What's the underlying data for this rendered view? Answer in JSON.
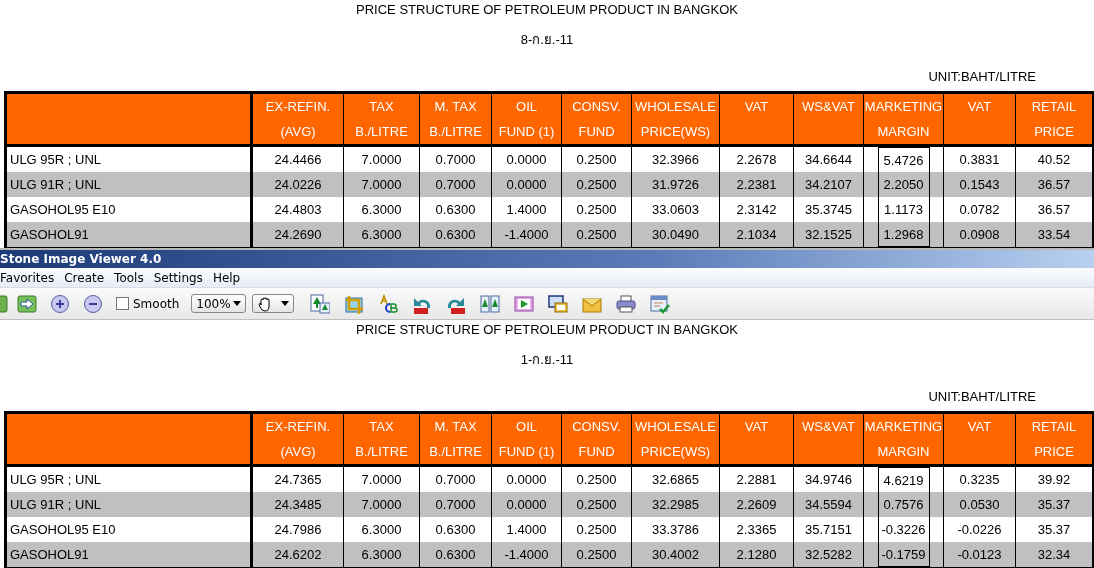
{
  "background_document": {
    "title": "PRICE STRUCTURE OF PETROLEUM PRODUCT IN BANGKOK",
    "date": "8-ก.ย.-11",
    "unit": "UNIT:BAHT/LITRE",
    "columns": [
      {
        "line1": "EX-REFIN.",
        "line2": "(AVG)"
      },
      {
        "line1": "TAX",
        "line2": "B./LITRE"
      },
      {
        "line1": "M. TAX",
        "line2": "B./LITRE"
      },
      {
        "line1": "OIL",
        "line2": "FUND (1)"
      },
      {
        "line1": "CONSV.",
        "line2": "FUND"
      },
      {
        "line1": "WHOLESALE",
        "line2": "PRICE(WS)"
      },
      {
        "line1": "VAT"
      },
      {
        "line1": "WS&VAT"
      },
      {
        "line1": "MARKETING",
        "line2": "MARGIN"
      },
      {
        "line1": "VAT"
      },
      {
        "line1": "RETAIL",
        "line2": "PRICE"
      }
    ],
    "rows": [
      {
        "product": "ULG 95R ; UNL",
        "cells": [
          "24.4466",
          "7.0000",
          "0.7000",
          "0.0000",
          "0.2500",
          "32.3966",
          "2.2678",
          "34.6644",
          "5.4726",
          "0.3831",
          "40.52"
        ]
      },
      {
        "product": "ULG 91R ; UNL",
        "cells": [
          "24.0226",
          "7.0000",
          "0.7000",
          "0.0000",
          "0.2500",
          "31.9726",
          "2.2381",
          "34.2107",
          "2.2050",
          "0.1543",
          "36.57"
        ]
      },
      {
        "product": "GASOHOL95 E10",
        "cells": [
          "24.4803",
          "6.3000",
          "0.6300",
          "1.4000",
          "0.2500",
          "33.0603",
          "2.3142",
          "35.3745",
          "1.1173",
          "0.0782",
          "36.57"
        ]
      },
      {
        "product": "GASOHOL91",
        "cells": [
          "24.2690",
          "6.3000",
          "0.6300",
          "-1.4000",
          "0.2500",
          "30.0490",
          "2.1034",
          "32.1525",
          "1.2968",
          "0.0908",
          "33.54"
        ]
      }
    ]
  },
  "viewer": {
    "title": "Stone Image Viewer 4.0",
    "menu": [
      "Favorites",
      "Create",
      "Tools",
      "Settings",
      "Help"
    ],
    "toolbar": {
      "smooth": {
        "label": "Smooth",
        "checked": false
      },
      "zoom": "100%"
    },
    "document": {
      "title": "PRICE STRUCTURE OF PETROLEUM PRODUCT IN BANGKOK",
      "date": "1-ก.ย.-11",
      "unit": "UNIT:BAHT/LITRE",
      "columns": [
        {
          "line1": "EX-REFIN.",
          "line2": "(AVG)"
        },
        {
          "line1": "TAX",
          "line2": "B./LITRE"
        },
        {
          "line1": "M. TAX",
          "line2": "B./LITRE"
        },
        {
          "line1": "OIL",
          "line2": "FUND (1)"
        },
        {
          "line1": "CONSV.",
          "line2": "FUND"
        },
        {
          "line1": "WHOLESALE",
          "line2": "PRICE(WS)"
        },
        {
          "line1": "VAT"
        },
        {
          "line1": "WS&VAT"
        },
        {
          "line1": "MARKETING",
          "line2": "MARGIN"
        },
        {
          "line1": "VAT"
        },
        {
          "line1": "RETAIL",
          "line2": "PRICE"
        }
      ],
      "rows": [
        {
          "product": "ULG 95R ; UNL",
          "cells": [
            "24.7365",
            "7.0000",
            "0.7000",
            "0.0000",
            "0.2500",
            "32.6865",
            "2.2881",
            "34.9746",
            "4.6219",
            "0.3235",
            "39.92"
          ]
        },
        {
          "product": "ULG 91R ; UNL",
          "cells": [
            "24.3485",
            "7.0000",
            "0.7000",
            "0.0000",
            "0.2500",
            "32.2985",
            "2.2609",
            "34.5594",
            "0.7576",
            "0.0530",
            "35.37"
          ]
        },
        {
          "product": "GASOHOL95 E10",
          "cells": [
            "24.7986",
            "6.3000",
            "0.6300",
            "1.4000",
            "0.2500",
            "33.3786",
            "2.3365",
            "35.7151",
            "-0.3226",
            "-0.0226",
            "35.37"
          ]
        },
        {
          "product": "GASOHOL91",
          "cells": [
            "24.6202",
            "6.3000",
            "0.6300",
            "-1.4000",
            "0.2500",
            "30.4002",
            "2.1280",
            "32.5282",
            "-0.1759",
            "-0.0123",
            "32.34"
          ]
        }
      ]
    }
  }
}
